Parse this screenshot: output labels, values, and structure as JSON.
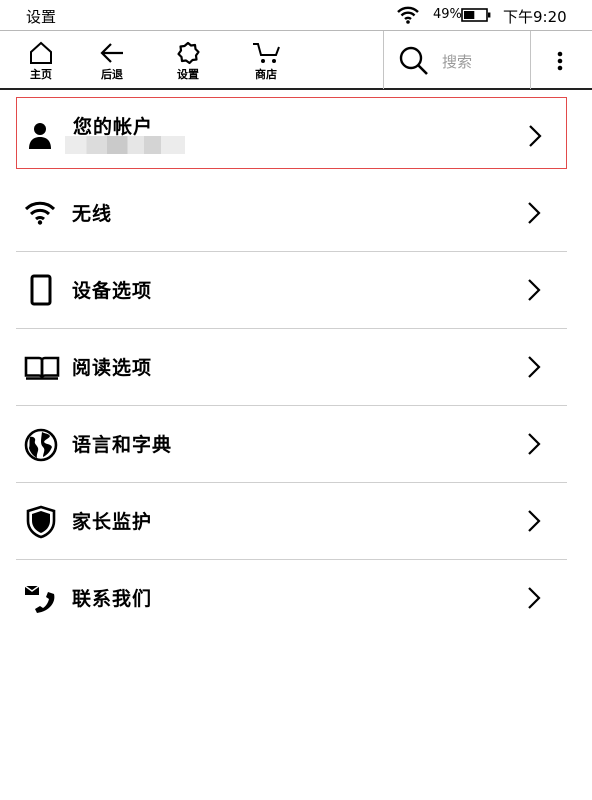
{
  "status_bar": {
    "title": "设置",
    "battery_percent": "49%",
    "battery_level": 0.49,
    "time": "下午9:20"
  },
  "toolbar": {
    "home_label": "主页",
    "back_label": "后退",
    "settings_label": "设置",
    "store_label": "商店",
    "search_placeholder": "搜索"
  },
  "settings": {
    "items": [
      {
        "label": "您的帐户",
        "icon": "person-icon",
        "highlighted": true
      },
      {
        "label": "无线",
        "icon": "wifi-icon"
      },
      {
        "label": "设备选项",
        "icon": "device-icon"
      },
      {
        "label": "阅读选项",
        "icon": "book-icon"
      },
      {
        "label": "语言和字典",
        "icon": "globe-icon"
      },
      {
        "label": "家长监护",
        "icon": "shield-icon"
      },
      {
        "label": "联系我们",
        "icon": "contact-icon"
      }
    ]
  },
  "colors": {
    "highlight_border": "#e24a4a",
    "divider": "#cfcfcf",
    "placeholder": "#9a9a9a"
  }
}
